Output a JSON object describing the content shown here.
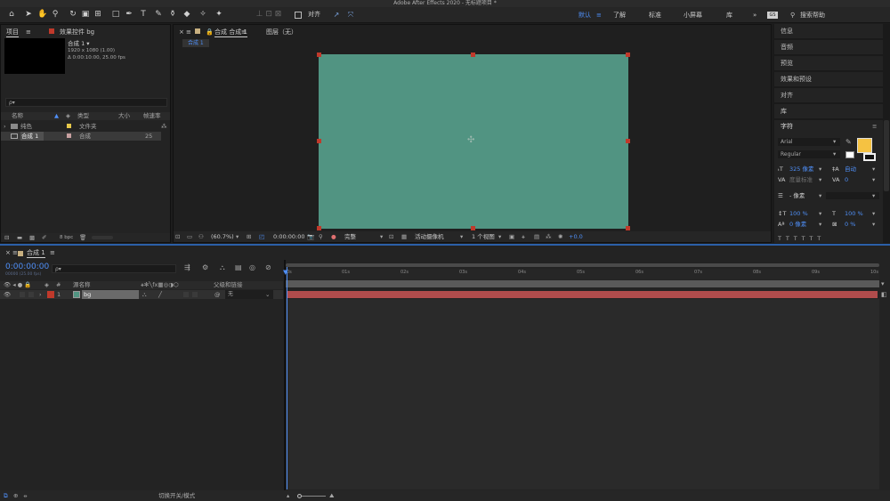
{
  "window": {
    "title": "Adobe After Effects 2020 - 无标题项目 *"
  },
  "toolbar": {
    "snap_label": "对齐"
  },
  "workspaces": [
    "默认",
    "了解",
    "标准",
    "小屏幕",
    "库"
  ],
  "search_help": "搜索帮助",
  "project": {
    "tab": "项目",
    "effects_tab": "效果控件 bg",
    "comp_name": "合成 1 ▾",
    "comp_res": "1920 x 1080 (1.00)",
    "comp_dur": "Δ 0:00:10:00, 25.00 fps",
    "search_placeholder": "ρ▾",
    "columns": {
      "name": "名称",
      "type": "类型",
      "size": "大小",
      "fps": "帧速率"
    },
    "items": [
      {
        "name": "纯色",
        "type": "文件夹",
        "fps": ""
      },
      {
        "name": "合成 1",
        "type": "合成",
        "fps": "25"
      }
    ],
    "bpc": "8 bpc"
  },
  "viewer": {
    "tab": "合成 合成 1",
    "layer_tab": "图层（无）",
    "breadcrumb": "合成 1",
    "zoom": "(60.7%)",
    "timecode": "0:00:00:00",
    "quality": "完整",
    "camera": "活动摄像机",
    "views": "1 个视图",
    "exposure": "+0.0"
  },
  "right_panels": [
    "信息",
    "音频",
    "预览",
    "效果和预设",
    "对齐",
    "库"
  ],
  "character": {
    "title": "字符",
    "font": "Arial",
    "style": "Regular",
    "size": "325 像素",
    "leading": "自动",
    "kerning": "度量标准",
    "tracking": "0",
    "stroke": "- 像素",
    "vscale": "100 %",
    "hscale": "100 %",
    "baseline": "0 像素",
    "tsume": "0 %"
  },
  "timeline": {
    "tab": "合成 1",
    "timecode": "0:00:00:00",
    "frames": "00000 (25.00 fps)",
    "search_placeholder": "ρ▾",
    "col_source": "源名称",
    "col_parent": "父级和链接",
    "col_hash": "#",
    "layer": {
      "index": "1",
      "name": "bg",
      "parent": "无"
    },
    "ruler": [
      "0s",
      "01s",
      "02s",
      "03s",
      "04s",
      "05s",
      "06s",
      "07s",
      "08s",
      "09s",
      "10s"
    ],
    "toggle_label": "切换开关/模式"
  },
  "colors": {
    "solid": "#519482",
    "accent": "#4f8ff7",
    "layer_bar": "#b04c4c",
    "label_red": "#c0392b"
  }
}
